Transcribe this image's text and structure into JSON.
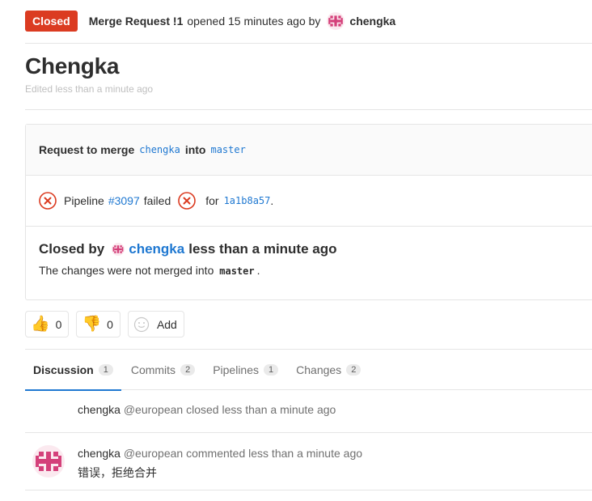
{
  "header": {
    "status_badge": "Closed",
    "mr_ref": "Merge Request !1",
    "opened_text": "opened 15 minutes ago by",
    "author": "chengka"
  },
  "title": "Chengka",
  "edited_text": "Edited less than a minute ago",
  "merge_box": {
    "request_label": "Request to merge",
    "source_branch": "chengka",
    "into_label": "into",
    "target_branch": "master",
    "pipeline_label": "Pipeline",
    "pipeline_id": "#3097",
    "pipeline_status": "failed",
    "for_label": "for",
    "commit_sha": "1a1b8a57",
    "closed_by_label": "Closed by",
    "closed_by_user": "chengka",
    "closed_time": "less than a minute ago",
    "changes_prefix": "The changes were not merged into",
    "changes_branch": "master",
    "changes_suffix": "."
  },
  "awards": {
    "thumbs_up_count": "0",
    "thumbs_down_count": "0",
    "add_label": "Add"
  },
  "tabs": [
    {
      "label": "Discussion",
      "count": "1",
      "active": true
    },
    {
      "label": "Commits",
      "count": "2",
      "active": false
    },
    {
      "label": "Pipelines",
      "count": "1",
      "active": false
    },
    {
      "label": "Changes",
      "count": "2",
      "active": false
    }
  ],
  "notes": [
    {
      "author": "chengka",
      "handle": "@european",
      "action": "closed less than a minute ago"
    },
    {
      "author": "chengka",
      "handle": "@european",
      "action": "commented less than a minute ago",
      "body": "错误，拒绝合并"
    }
  ],
  "colors": {
    "closed_red": "#db3b21",
    "link_blue": "#1f78d1",
    "avatar_pink": "#d4407a"
  }
}
